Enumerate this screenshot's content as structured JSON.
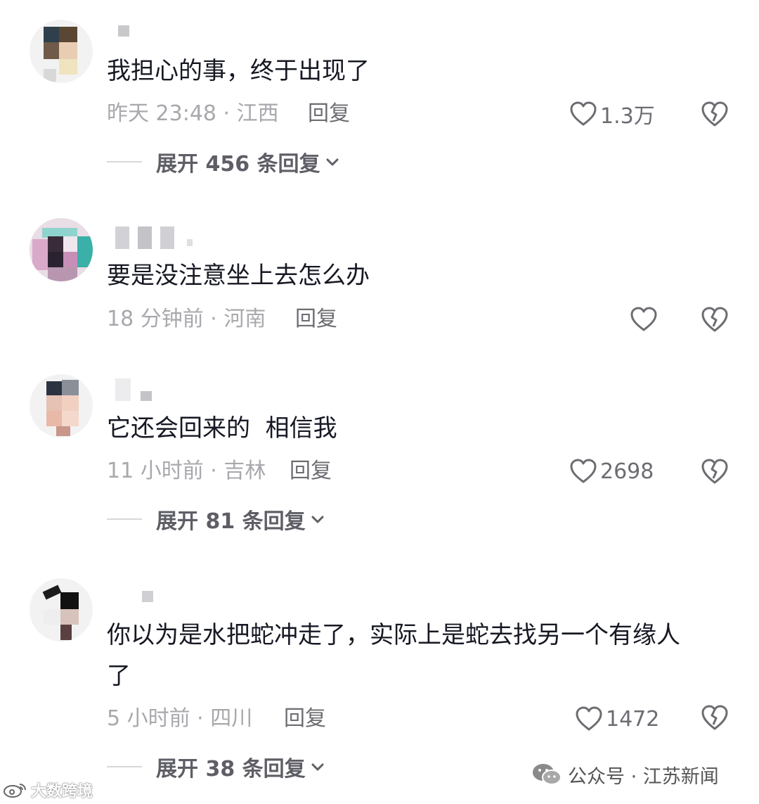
{
  "comments": [
    {
      "text": "我担心的事，终于出现了",
      "meta": "昨天 23:48 · 江西",
      "reply_label": "回复",
      "likes": "1.3万",
      "expand_label": "展开 456 条回复"
    },
    {
      "text": "要是没注意坐上去怎么办",
      "meta": "18 分钟前 · 河南",
      "reply_label": "回复",
      "likes": ""
    },
    {
      "text": "它还会回来的  相信我",
      "meta": "11 小时前 · 吉林",
      "reply_label": "回复",
      "likes": "2698",
      "expand_label": "展开 81 条回复"
    },
    {
      "text": "你以为是水把蛇冲走了，实际上是蛇去找另一个有缘人\n了",
      "meta": "5 小时前 · 四川",
      "reply_label": "回复",
      "likes": "1472",
      "expand_label": "展开 38 条回复"
    }
  ],
  "watermark_left": "大数跨境",
  "watermark_right": "公众号 · 江苏新闻",
  "icons": {
    "like": "heart-outline-icon",
    "dislike": "broken-heart-icon",
    "expand": "chevron-down-icon"
  },
  "colors": {
    "text": "#161823",
    "meta": "#a8a8ad",
    "action": "#6c6c72"
  }
}
